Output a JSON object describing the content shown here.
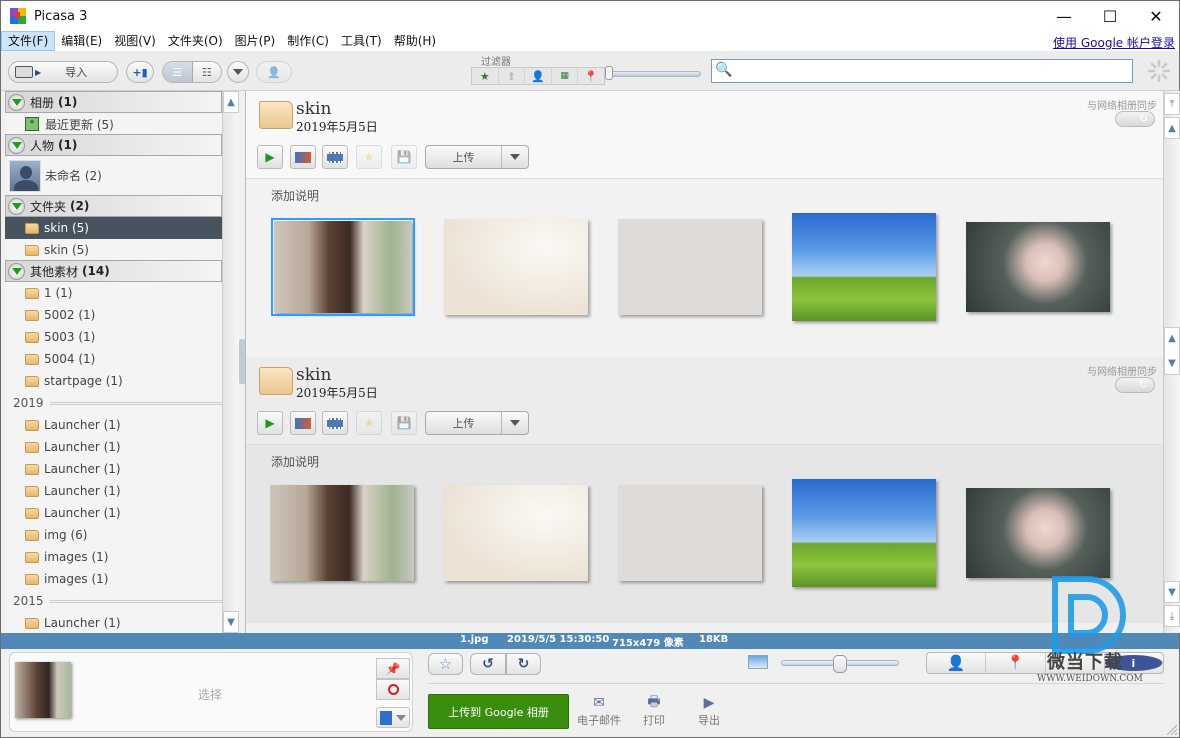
{
  "window": {
    "title": "Picasa 3",
    "controls": {
      "minimize": "—",
      "maximize": "☐",
      "close": "✕"
    }
  },
  "menu": {
    "items": [
      "文件(F)",
      "编辑(E)",
      "视图(V)",
      "文件夹(O)",
      "图片(P)",
      "制作(C)",
      "工具(T)",
      "帮助(H)"
    ],
    "active_index": 0,
    "login_link": "使用 Google 帐户登录"
  },
  "toolbar": {
    "import_label": "导入",
    "filter_label": "过滤器",
    "filters": [
      "star-icon",
      "upload-arrow-icon",
      "person-icon",
      "movie-icon",
      "map-pin-icon"
    ],
    "search_placeholder": "",
    "search_value": ""
  },
  "sidebar": {
    "sections": [
      {
        "title": "相册",
        "count": "(1)",
        "items": [
          {
            "label": "最近更新 (5)",
            "icon": "album-icon"
          }
        ]
      },
      {
        "title": "人物",
        "count": "(1)",
        "items": [
          {
            "label": "未命名 (2)",
            "icon": "person-avatar"
          }
        ]
      },
      {
        "title": "文件夹",
        "count": "(2)",
        "items": [
          {
            "label": "skin (5)",
            "selected": true
          },
          {
            "label": "skin (5)"
          }
        ]
      },
      {
        "title": "其他素材",
        "count": "(14)",
        "items": [
          {
            "label": "1 (1)"
          },
          {
            "label": "5002 (1)"
          },
          {
            "label": "5003 (1)"
          },
          {
            "label": "5004 (1)"
          },
          {
            "label": "startpage (1)"
          }
        ]
      }
    ],
    "year_groups": [
      {
        "year": "2019",
        "items": [
          "Launcher (1)",
          "Launcher (1)",
          "Launcher (1)",
          "Launcher (1)",
          "Launcher (1)",
          "img (6)",
          "images (1)",
          "images (1)"
        ]
      },
      {
        "year": "2015",
        "items": [
          "Launcher (1)"
        ]
      }
    ]
  },
  "albums": [
    {
      "title": "skin",
      "date": "2019年5月5日",
      "sync_label": "与网络相册同步",
      "upload_label": "上传",
      "caption_placeholder": "添加说明",
      "photos": [
        "woman-portrait",
        "ink-boats",
        "plum-blossom",
        "green-field",
        "woman-garden"
      ],
      "selected_photo": 0
    },
    {
      "title": "skin",
      "date": "2019年5月5日",
      "sync_label": "与网络相册同步",
      "upload_label": "上传",
      "caption_placeholder": "添加说明",
      "photos": [
        "woman-portrait",
        "ink-boats",
        "plum-blossom",
        "green-field",
        "woman-garden"
      ],
      "selected_photo": null
    }
  ],
  "status": {
    "filename": "1.jpg",
    "datetime": "2019/5/5 15:30:50",
    "dimensions": "715x479 像素",
    "size": "18KB"
  },
  "tray": {
    "label": "选择"
  },
  "bottom_actions": {
    "upload_google": "上传到 Google 相册",
    "email": "电子邮件",
    "print": "打印",
    "export": "导出",
    "zoom_level": 0.5
  },
  "watermark": {
    "brand": "微当下载",
    "url": "WWW.WEIDOWN.COM",
    "color": "#1e9be6"
  },
  "colors": {
    "status_bar": "#5089b8",
    "selection": "#475460",
    "upload_green": "#3a8e0e",
    "thumb_selection": "#29a0ff"
  }
}
